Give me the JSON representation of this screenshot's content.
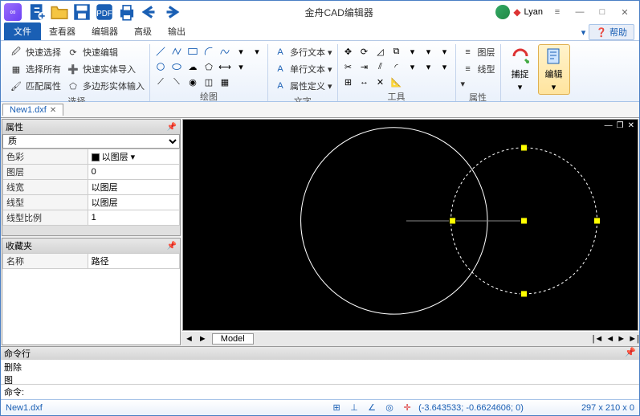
{
  "app": {
    "title": "金舟CAD编辑器"
  },
  "user": {
    "name": "Lyan"
  },
  "win": {
    "menu": "≡",
    "min": "—",
    "max": "□",
    "close": "✕"
  },
  "qat": [
    "new",
    "open",
    "save",
    "pdf",
    "print",
    "undo",
    "redo"
  ],
  "tabs": {
    "file": "文件",
    "viewer": "查看器",
    "editor": "编辑器",
    "advanced": "高级",
    "output": "输出"
  },
  "help": {
    "label": "帮助"
  },
  "ribbon": {
    "select": {
      "label": "选择",
      "quick": "快速选择",
      "edit_quick": "快速编辑",
      "all": "选择所有",
      "ent_import": "快速实体导入",
      "match": "匹配属性",
      "poly_import": "多边形实体输入"
    },
    "draw": {
      "label": "绘图"
    },
    "text": {
      "label": "文字",
      "multi": "多行文本",
      "single": "单行文本",
      "attr": "属性定义"
    },
    "tools": {
      "label": "工具"
    },
    "props": {
      "label": "属性",
      "layer": "图层",
      "linetype": "线型"
    },
    "capture": {
      "label": "捕捉"
    },
    "edit": {
      "label": "编辑"
    }
  },
  "doc": {
    "name": "New1.dxf",
    "close": "✕"
  },
  "left": {
    "props_hdr": "属性",
    "combo": "质",
    "rows": {
      "color_k": "色彩",
      "color_v": "以图层",
      "layer_k": "图层",
      "layer_v": "0",
      "lw_k": "线宽",
      "lw_v": "以图层",
      "lt_k": "线型",
      "lt_v": "以图层",
      "ls_k": "线型比例",
      "ls_v": "1"
    },
    "fav_hdr": "收藏夹",
    "fav_cols": {
      "name": "名称",
      "path": "路径"
    }
  },
  "model": {
    "arrow_l": "◄",
    "arrow_r": "►",
    "tab": "Model",
    "nav": "|◄ ◄ ► ►|"
  },
  "cmd": {
    "hdr": "命令行",
    "out": "删除\n图",
    "prompt": "命令:"
  },
  "status": {
    "file": "New1.dxf",
    "coords": "(-3.643533; -0.6624606; 0)",
    "dims": "297 x 210 x 0"
  },
  "colors": {
    "accent": "#1a5fb4"
  }
}
